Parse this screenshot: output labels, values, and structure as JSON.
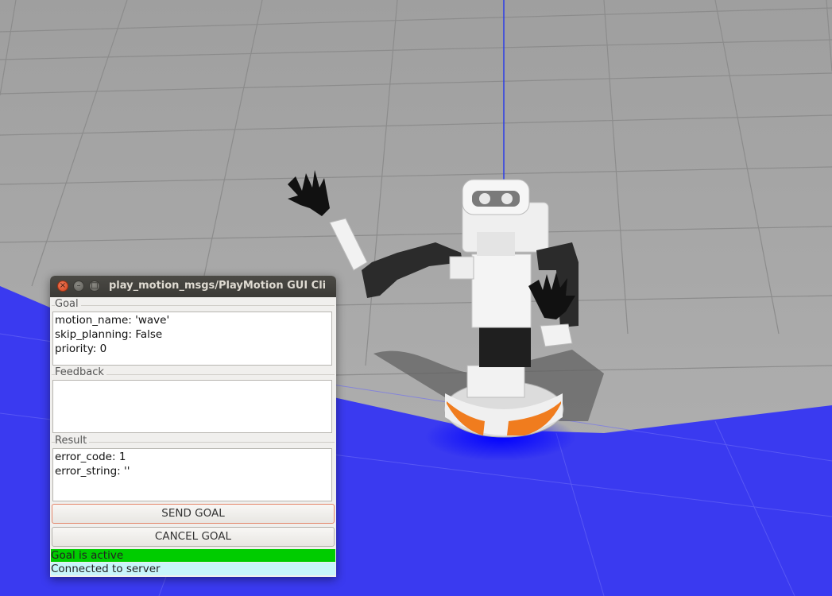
{
  "window": {
    "title": "play_motion_msgs/PlayMotion GUI Cli",
    "controls": [
      "close-icon",
      "minimize-icon",
      "maximize-icon"
    ]
  },
  "goal": {
    "label": "Goal",
    "lines": [
      "motion_name: 'wave'",
      "skip_planning: False",
      "priority: 0"
    ]
  },
  "feedback": {
    "label": "Feedback",
    "lines": []
  },
  "result": {
    "label": "Result",
    "lines": [
      "error_code: 1",
      "error_string: ''"
    ]
  },
  "buttons": {
    "send": "SEND GOAL",
    "cancel": "CANCEL GOAL"
  },
  "status": {
    "goal": "Goal is active",
    "goal_color": "#00cc00",
    "connection": "Connected to server",
    "connection_color": "#c8f5fa"
  },
  "colors": {
    "floor_blue": "#3a3af0",
    "ground_gray": "#a9a9a9",
    "robot_accent": "#f07c1e"
  }
}
